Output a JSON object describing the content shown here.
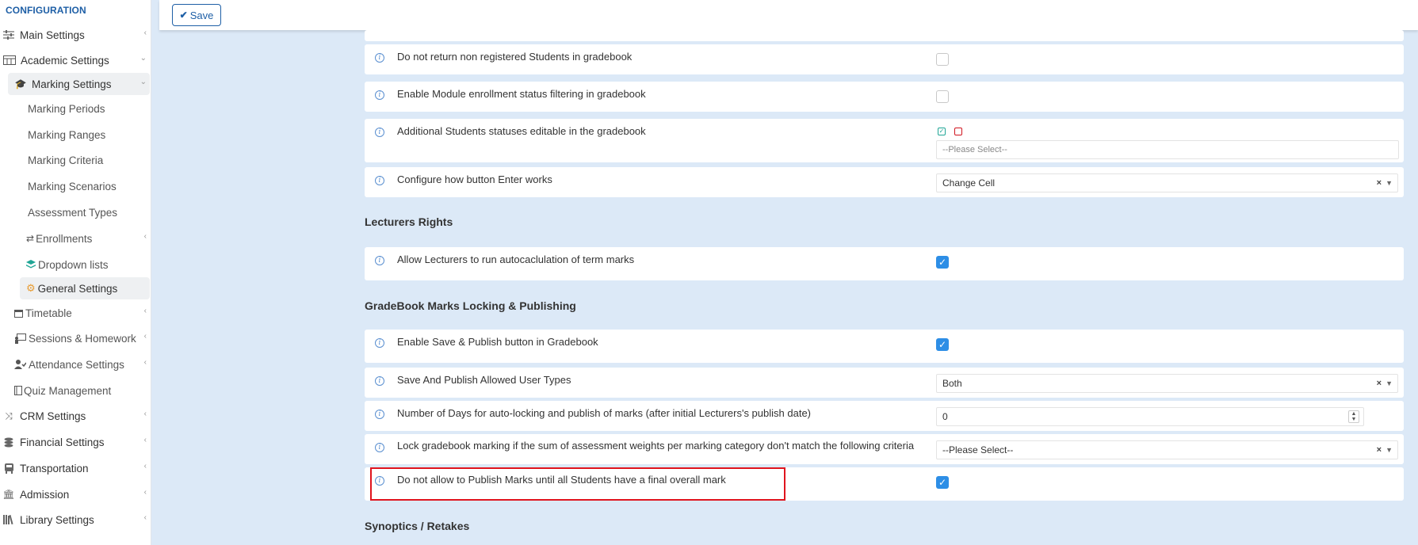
{
  "sidebar": {
    "header": "CONFIGURATION",
    "items": {
      "main_settings": "Main Settings",
      "academic_settings": "Academic Settings",
      "marking_settings": "Marking Settings",
      "marking_periods": "Marking Periods",
      "marking_ranges": "Marking Ranges",
      "marking_criteria": "Marking Criteria",
      "marking_scenarios": "Marking Scenarios",
      "assessment_types": "Assessment Types",
      "enrollments": "Enrollments",
      "dropdown_lists": "Dropdown lists",
      "general_settings": "General Settings",
      "timetable": "Timetable",
      "sessions_homework": "Sessions & Homework",
      "attendance_settings": "Attendance Settings",
      "quiz_management": "Quiz Management",
      "crm_settings": "CRM Settings",
      "financial_settings": "Financial Settings",
      "transportation": "Transportation",
      "admission": "Admission",
      "library_settings": "Library Settings"
    }
  },
  "toolbar": {
    "save_label": "Save"
  },
  "rows": {
    "r1": "Do not return non registered Students in gradebook",
    "r2": "Enable Module enrollment status filtering in gradebook",
    "r3": "Additional Students statuses editable in the gradebook",
    "r3_placeholder": "--Please Select--",
    "r4": "Configure how button Enter works",
    "r4_value": "Change Cell",
    "r5": "Allow Lecturers to run autocaclulation of term marks",
    "r6": "Enable Save & Publish button in Gradebook",
    "r7": "Save And Publish Allowed User Types",
    "r7_value": "Both",
    "r8": "Number of Days for auto-locking and publish of marks (after initial Lecturers's publish date)",
    "r8_value": "0",
    "r9": "Lock gradebook marking if the sum of assessment weights per marking category don't match the following criteria",
    "r9_value": "--Please Select--",
    "r10": "Do not allow to Publish Marks until all Students have a final overall mark"
  },
  "sections": {
    "lecturers_rights": "Lecturers Rights",
    "gradebook_locking": "GradeBook Marks Locking & Publishing",
    "synoptics": "Synoptics / Retakes"
  },
  "colors": {
    "accent": "#1e5fa6",
    "checkbox": "#2d8ee6",
    "highlight": "#e0141e",
    "background": "#dce9f7"
  }
}
